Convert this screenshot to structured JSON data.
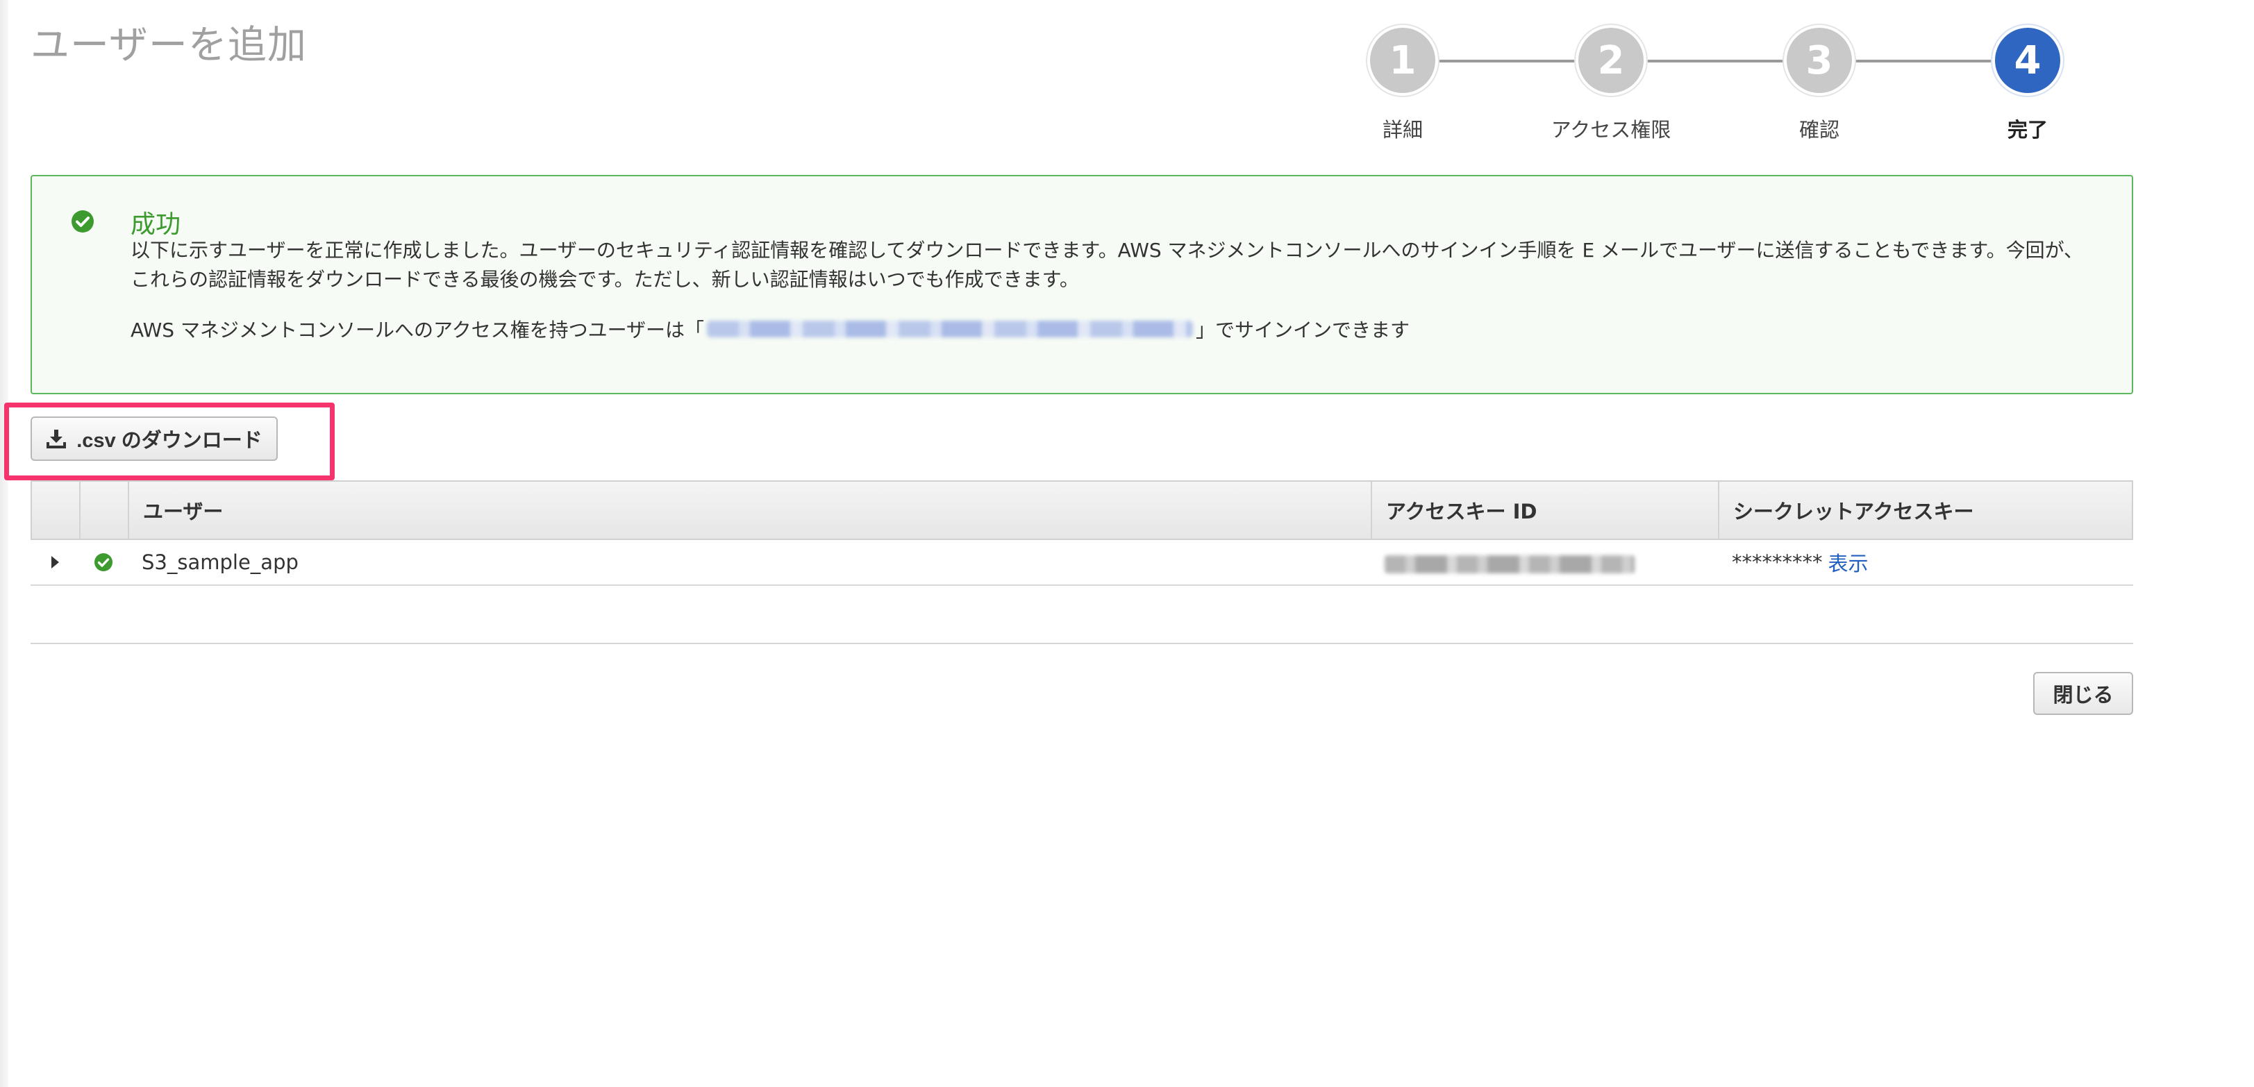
{
  "page": {
    "title": "ユーザーを追加"
  },
  "steps": [
    {
      "number": "1",
      "label": "詳細",
      "active": false
    },
    {
      "number": "2",
      "label": "アクセス権限",
      "active": false
    },
    {
      "number": "3",
      "label": "確認",
      "active": false
    },
    {
      "number": "4",
      "label": "完了",
      "active": true
    }
  ],
  "success": {
    "icon": "check-circle-icon",
    "title": "成功",
    "message": "以下に示すユーザーを正常に作成しました。ユーザーのセキュリティ認証情報を確認してダウンロードできます。AWS マネジメントコンソールへのサインイン手順を E メールでユーザーに送信することもできます。今回が、これらの認証情報をダウンロードできる最後の機会です。ただし、新しい認証情報はいつでも作成できます。",
    "signin_prefix": "AWS マネジメントコンソールへのアクセス権を持つユーザーは「",
    "signin_suffix": "」でサインインできます"
  },
  "csv_button": {
    "icon": "download-icon",
    "label": ".csv のダウンロード"
  },
  "table": {
    "headers": {
      "user": "ユーザー",
      "access_key_id": "アクセスキー ID",
      "secret_access_key": "シークレットアクセスキー"
    },
    "rows": [
      {
        "user": "S3_sample_app",
        "secret_masked": "*********",
        "show_label": "表示"
      }
    ]
  },
  "close_button": {
    "label": "閉じる"
  },
  "colors": {
    "accent": "#2f66c2",
    "success": "#5cb85c",
    "highlight": "#f6336c",
    "link": "#1f5fbf"
  }
}
